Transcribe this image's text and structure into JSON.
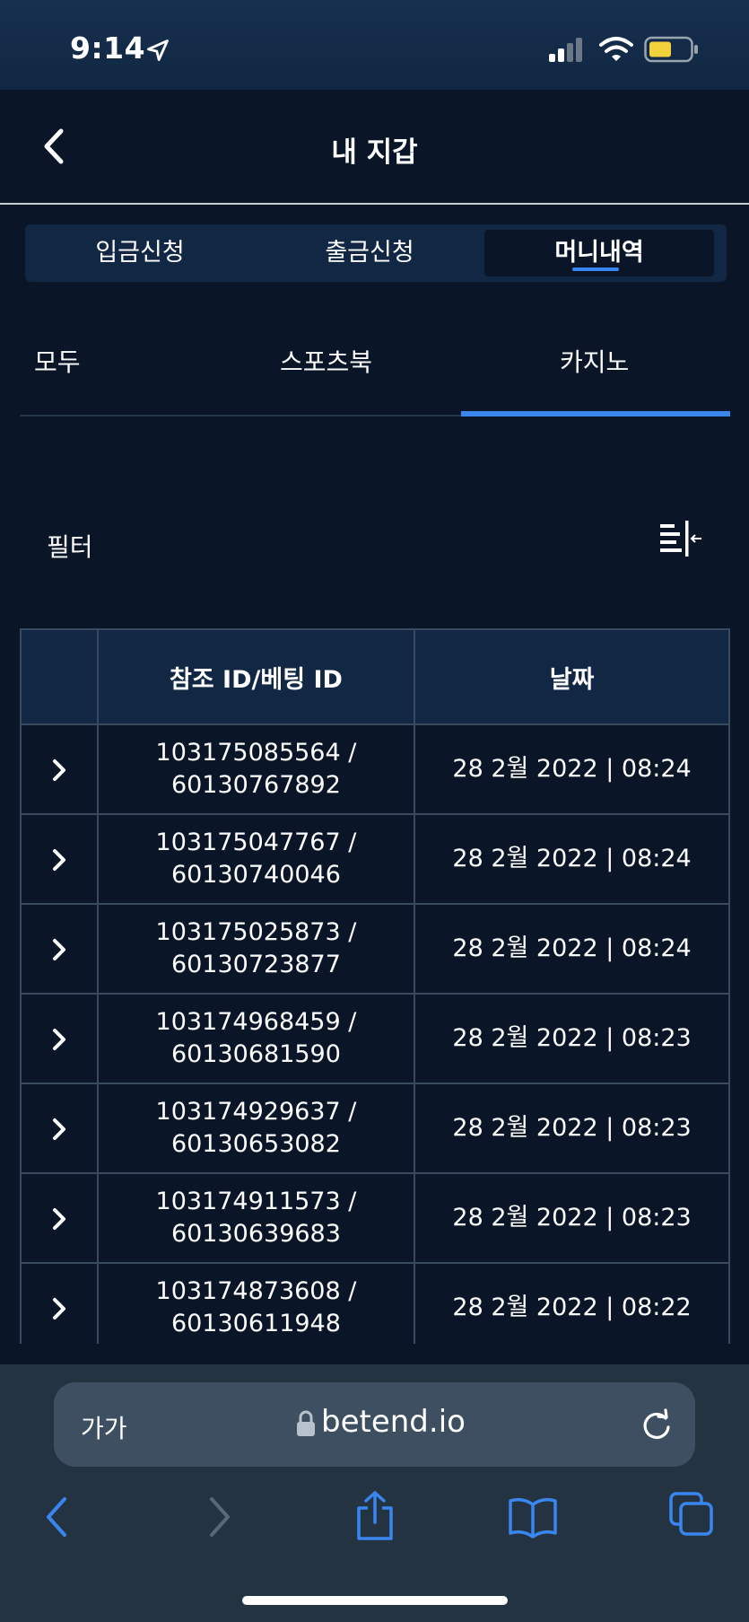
{
  "status_bar": {
    "time": "9:14"
  },
  "header": {
    "title": "내 지갑"
  },
  "segment_tabs": [
    {
      "label": "입금신청",
      "active": false
    },
    {
      "label": "출금신청",
      "active": false
    },
    {
      "label": "머니내역",
      "active": true
    }
  ],
  "sub_tabs": [
    {
      "label": "모두",
      "active": false
    },
    {
      "label": "스포츠북",
      "active": false
    },
    {
      "label": "카지노",
      "active": true
    }
  ],
  "filter": {
    "label": "필터",
    "icon": "filter-sort-icon"
  },
  "table": {
    "headers": [
      "",
      "참조 ID/베팅 ID",
      "날짜"
    ],
    "rows": [
      {
        "ref_id": "103175085564 /",
        "bet_id": "60130767892",
        "date": "28 2월 2022 | 08:24"
      },
      {
        "ref_id": "103175047767 /",
        "bet_id": "60130740046",
        "date": "28 2월 2022 | 08:24"
      },
      {
        "ref_id": "103175025873 /",
        "bet_id": "60130723877",
        "date": "28 2월 2022 | 08:24"
      },
      {
        "ref_id": "103174968459 /",
        "bet_id": "60130681590",
        "date": "28 2월 2022 | 08:23"
      },
      {
        "ref_id": "103174929637 /",
        "bet_id": "60130653082",
        "date": "28 2월 2022 | 08:23"
      },
      {
        "ref_id": "103174911573 /",
        "bet_id": "60130639683",
        "date": "28 2월 2022 | 08:23"
      },
      {
        "ref_id": "103174873608 /",
        "bet_id": "60130611948",
        "date": "28 2월 2022 | 08:22"
      }
    ]
  },
  "browser": {
    "aa_label": "가가",
    "url": "betend.io"
  },
  "colors": {
    "background": "#0a1628",
    "accent": "#3a86f0",
    "panel": "#112743"
  }
}
